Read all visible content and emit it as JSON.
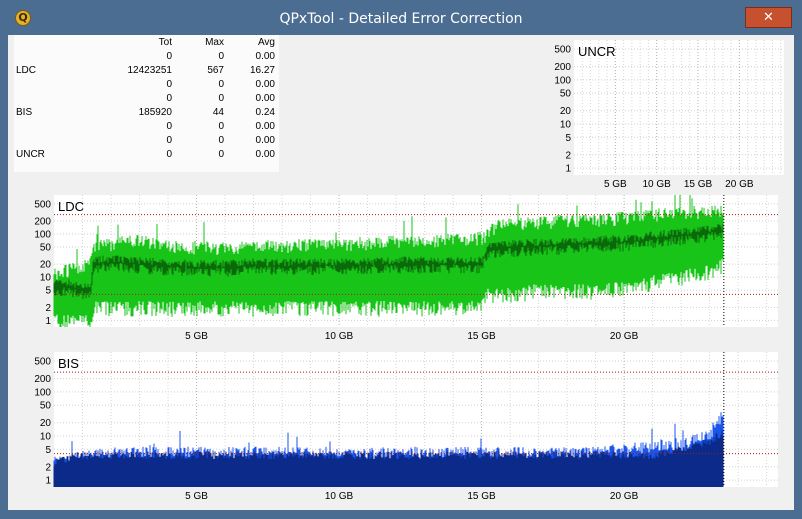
{
  "window": {
    "title": "QPxTool - Detailed Error Correction",
    "app_icon_glyph": "Q",
    "close_glyph": "✕"
  },
  "stats_table": {
    "headers": [
      "",
      "Tot",
      "Max",
      "Avg"
    ],
    "rows": [
      [
        "",
        "0",
        "0",
        "0.00"
      ],
      [
        "LDC",
        "12423251",
        "567",
        "16.27"
      ],
      [
        "",
        "0",
        "0",
        "0.00"
      ],
      [
        "",
        "0",
        "0",
        "0.00"
      ],
      [
        "BIS",
        "185920",
        "44",
        "0.24"
      ],
      [
        "",
        "0",
        "0",
        "0.00"
      ],
      [
        "",
        "0",
        "0",
        "0.00"
      ],
      [
        "UNCR",
        "0",
        "0",
        "0.00"
      ]
    ]
  },
  "colors": {
    "ldc_light": "#18c418",
    "ldc_dark": "#0a6a0a",
    "bis_light": "#1a55ee",
    "bis_dark": "#0b2a8a",
    "threshold": "#b01818"
  },
  "chart_data": [
    {
      "type": "area",
      "title": "UNCR",
      "y_scale": "log",
      "y_ticks": [
        "500",
        "200",
        "100",
        "50",
        "20",
        "10",
        "5",
        "2",
        "1"
      ],
      "x_ticks": [
        "5 GB",
        "10 GB",
        "15 GB",
        "20 GB"
      ],
      "xlim": [
        0,
        25.4
      ],
      "series": []
    },
    {
      "type": "area",
      "title": "LDC",
      "y_scale": "log",
      "y_ticks": [
        "500",
        "200",
        "100",
        "50",
        "20",
        "10",
        "5",
        "2",
        "1"
      ],
      "x_ticks": [
        "5 GB",
        "10 GB",
        "15 GB",
        "20 GB"
      ],
      "xlim": [
        0,
        25.4
      ],
      "end_marker_x": 23.5,
      "threshold_lines": [
        280,
        4
      ],
      "series": [
        {
          "x": [
            0,
            0.5,
            1,
            1.3,
            1.4,
            2,
            3,
            4,
            5,
            6,
            7,
            8,
            9,
            10,
            11,
            12,
            13,
            14,
            15,
            15.2,
            15.5,
            16,
            17,
            18,
            19,
            20,
            20.5,
            21,
            22,
            23,
            23.5
          ],
          "max": [
            15,
            18,
            20,
            30,
            60,
            70,
            90,
            60,
            60,
            55,
            60,
            65,
            70,
            70,
            75,
            80,
            85,
            90,
            100,
            120,
            180,
            200,
            220,
            250,
            260,
            290,
            300,
            330,
            380,
            420,
            450
          ],
          "avg": [
            6,
            6,
            5,
            5,
            20,
            22,
            20,
            18,
            17,
            17,
            18,
            18,
            18,
            19,
            19,
            20,
            20,
            20,
            20,
            40,
            45,
            48,
            52,
            55,
            60,
            65,
            70,
            78,
            90,
            110,
            120
          ],
          "min": [
            1,
            1,
            1,
            1,
            2,
            2,
            2,
            2,
            2,
            2,
            2,
            2,
            2,
            2,
            2,
            2,
            2,
            2,
            2,
            4,
            4,
            4,
            5,
            5,
            5,
            6,
            6,
            8,
            10,
            14,
            20
          ]
        }
      ]
    },
    {
      "type": "area",
      "title": "BIS",
      "y_scale": "log",
      "y_ticks": [
        "500",
        "200",
        "100",
        "50",
        "20",
        "10",
        "5",
        "2",
        "1"
      ],
      "x_ticks": [
        "5 GB",
        "10 GB",
        "15 GB",
        "20 GB"
      ],
      "xlim": [
        0,
        25.4
      ],
      "end_marker_x": 23.5,
      "threshold_lines": [
        280,
        4
      ],
      "series": [
        {
          "x": [
            0,
            1,
            2,
            3,
            4,
            5,
            6,
            7,
            8,
            9,
            10,
            11,
            12,
            13,
            14,
            15,
            16,
            17,
            18,
            19,
            20,
            21,
            22,
            23,
            23.5
          ],
          "max": [
            3,
            4,
            5,
            5,
            5,
            5,
            5,
            5,
            5,
            5,
            5,
            5,
            5,
            5,
            5,
            5,
            5,
            5,
            5,
            5,
            6,
            7,
            8,
            12,
            40
          ],
          "avg": [
            2,
            3,
            3,
            3,
            3,
            3,
            3,
            3,
            3,
            3,
            3,
            3,
            3,
            3,
            3,
            3,
            3,
            3,
            3,
            3,
            3,
            3,
            4,
            6,
            10
          ]
        }
      ]
    }
  ]
}
